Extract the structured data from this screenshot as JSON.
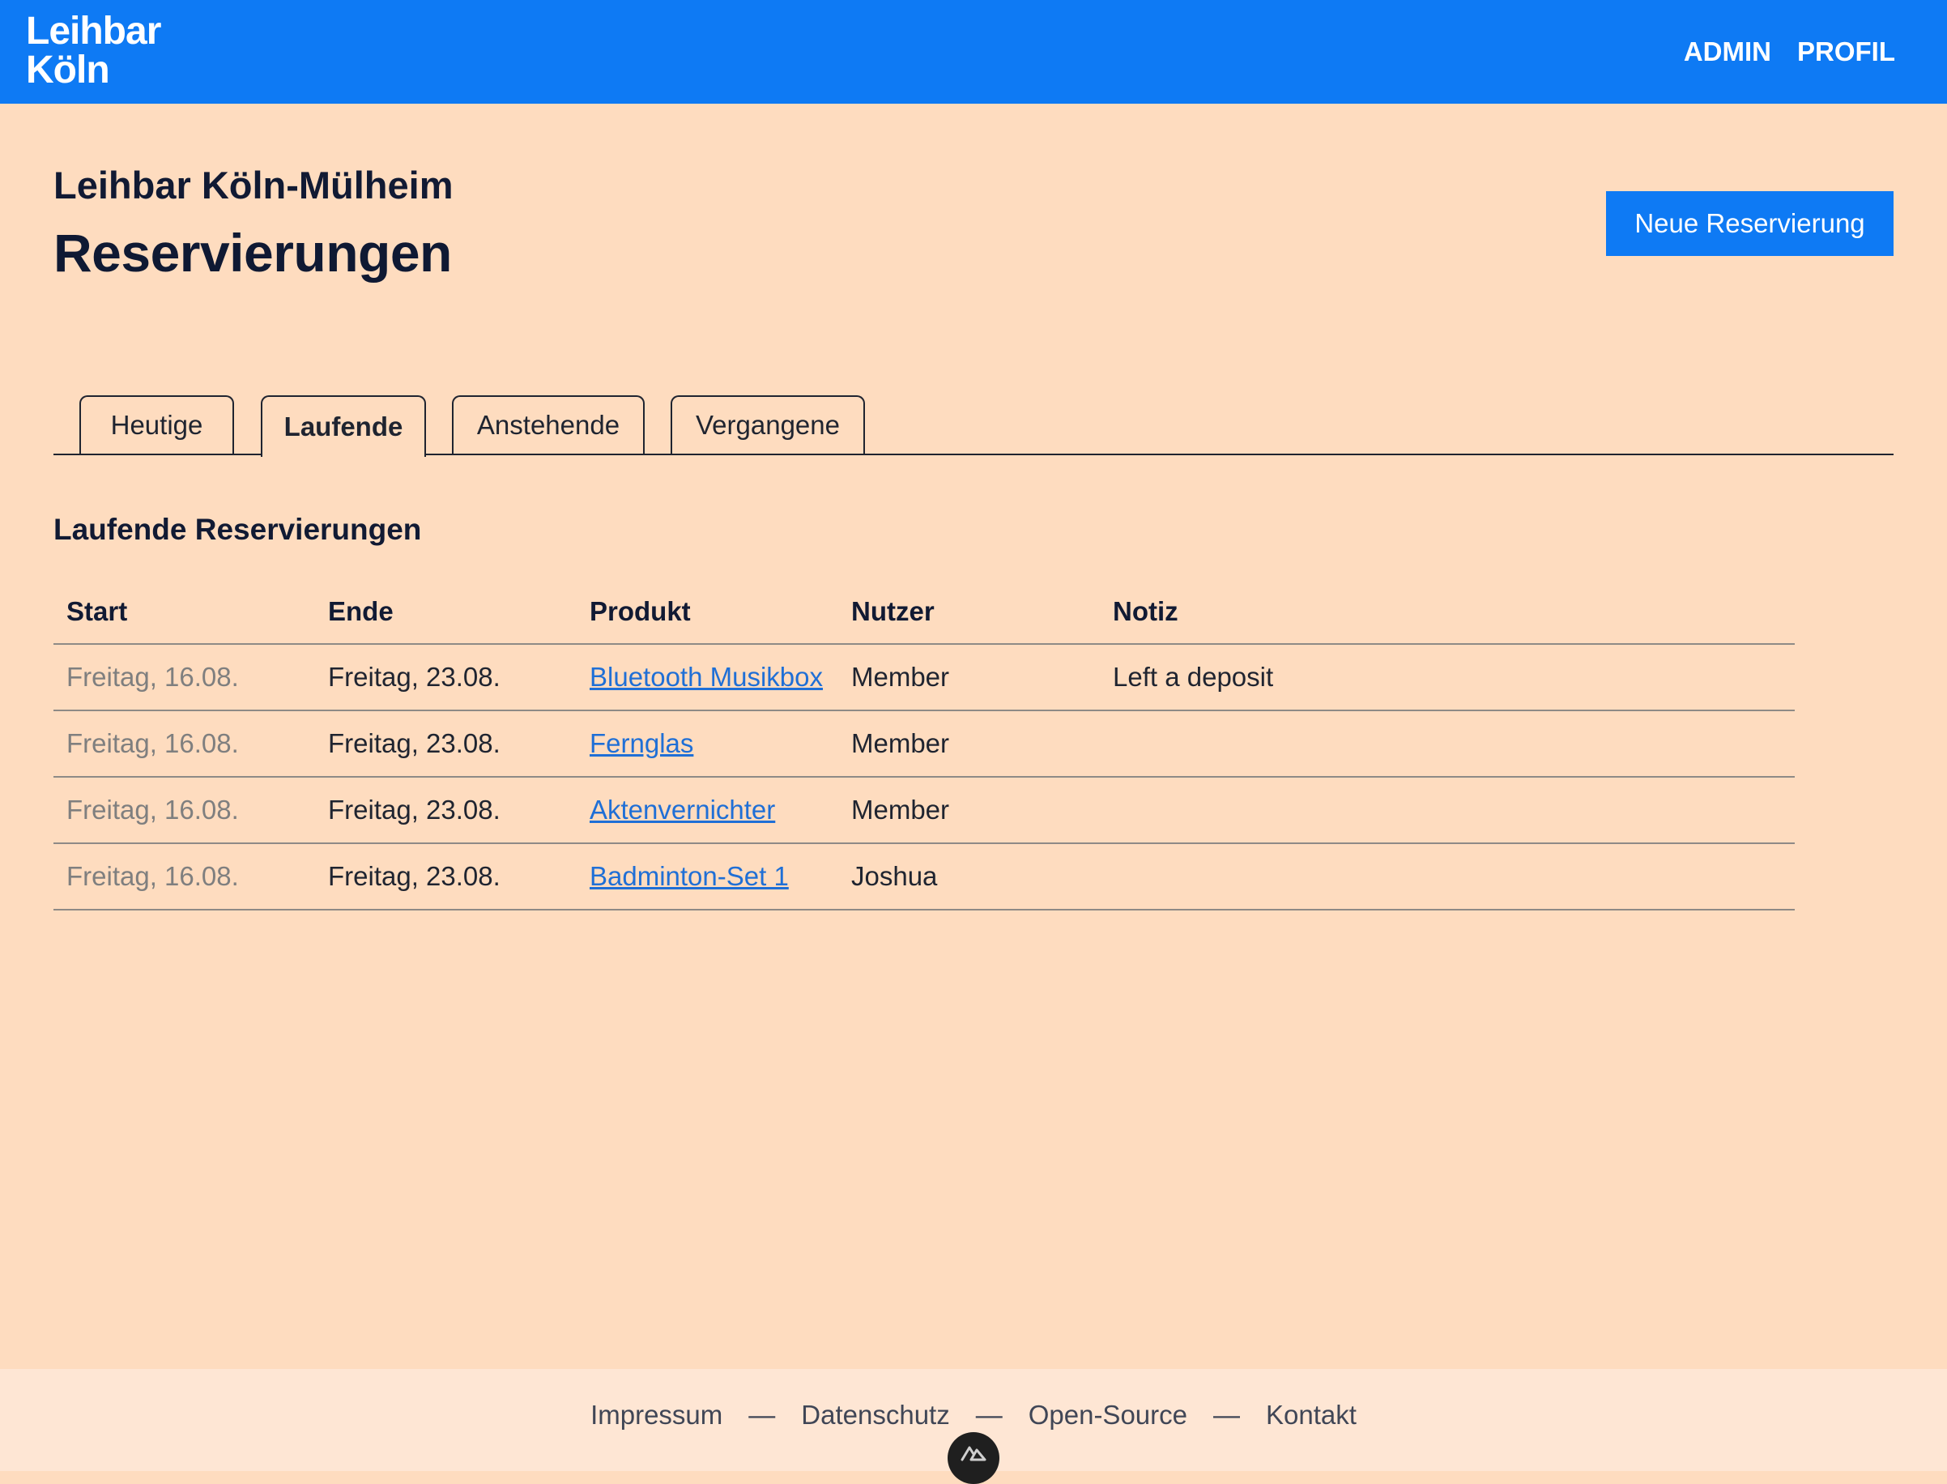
{
  "header": {
    "logo_line1": "Leihbar",
    "logo_line2": "Köln",
    "nav": [
      "ADMIN",
      "PROFIL"
    ]
  },
  "page": {
    "location": "Leihbar Köln-Mülheim",
    "title": "Reservierungen",
    "new_button": "Neue Reservierung"
  },
  "tabs": [
    {
      "label": "Heutige",
      "active": false
    },
    {
      "label": "Laufende",
      "active": true
    },
    {
      "label": "Anstehende",
      "active": false
    },
    {
      "label": "Vergangene",
      "active": false
    }
  ],
  "section": {
    "title": "Laufende Reservierungen",
    "columns": [
      "Start",
      "Ende",
      "Produkt",
      "Nutzer",
      "Notiz"
    ],
    "rows": [
      {
        "start": "Freitag, 16.08.",
        "end": "Freitag, 23.08.",
        "product": "Bluetooth Musikbox",
        "user": "Member",
        "note": "Left a deposit"
      },
      {
        "start": "Freitag, 16.08.",
        "end": "Freitag, 23.08.",
        "product": "Fernglas",
        "user": "Member",
        "note": ""
      },
      {
        "start": "Freitag, 16.08.",
        "end": "Freitag, 23.08.",
        "product": "Aktenvernichter",
        "user": "Member",
        "note": ""
      },
      {
        "start": "Freitag, 16.08.",
        "end": "Freitag, 23.08.",
        "product": "Badminton-Set 1",
        "user": "Joshua",
        "note": ""
      }
    ]
  },
  "footer": {
    "links": [
      "Impressum",
      "Datenschutz",
      "Open-Source",
      "Kontakt"
    ],
    "separator": "—"
  },
  "colors": {
    "brand_blue": "#0e7af4",
    "page_background": "#fedcbf",
    "footer_background": "#fee6d4",
    "link": "#1f6fd6"
  },
  "icons": {
    "dev_badge": "nuxt-devtools-icon"
  }
}
